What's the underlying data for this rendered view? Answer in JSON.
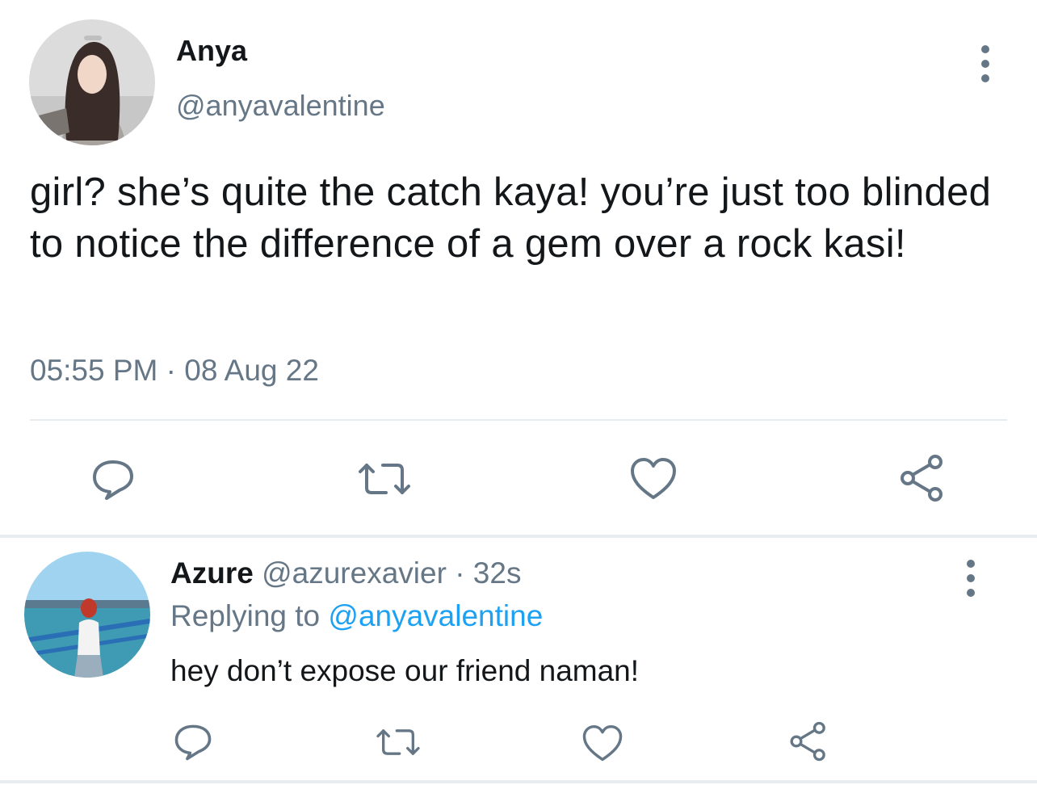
{
  "main_tweet": {
    "display_name": "Anya",
    "handle": "@anyavalentine",
    "text": "girl? she’s quite the catch kaya! you’re just too blinded to notice the difference of a gem over a rock kasi!",
    "timestamp": "05:55 PM · 08 Aug 22",
    "actions": [
      "reply-icon",
      "retweet-icon",
      "like-icon",
      "share-icon"
    ]
  },
  "reply": {
    "display_name": "Azure",
    "handle": "@azurexavier",
    "separator": "·",
    "time_ago": "32s",
    "replying_label": "Replying to",
    "replying_handle": "@anyavalentine",
    "text": "hey don’t expose our friend naman!",
    "actions": [
      "reply-icon",
      "retweet-icon",
      "like-icon",
      "share-icon"
    ]
  },
  "colors": {
    "text": "#14171a",
    "secondary": "#657786",
    "link": "#1da1f2",
    "divider": "#e6ecf0"
  }
}
